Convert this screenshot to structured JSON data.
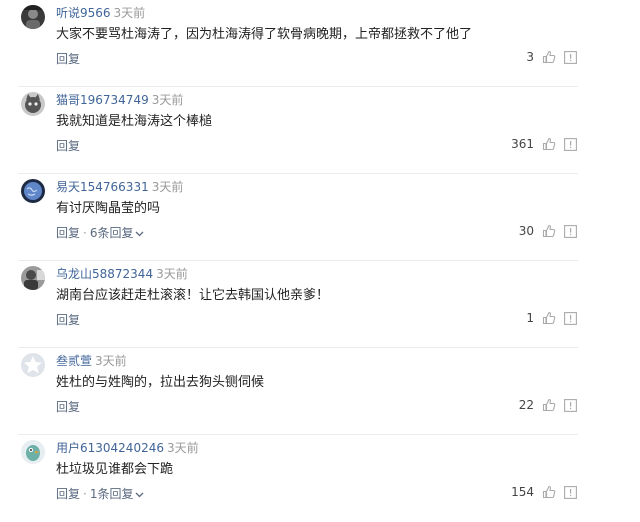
{
  "comments": [
    {
      "username": "听说9566",
      "time": "3天前",
      "text": "大家不要骂杜海涛了，因为杜海涛得了软骨病晚期，上帝都拯救不了他了",
      "reply_label": "回复",
      "replies_label": "",
      "likes": "3",
      "avatar_icon": "avatar-dark-icon"
    },
    {
      "username": "猫哥196734749",
      "time": "3天前",
      "text": "我就知道是杜海涛这个棒槌",
      "reply_label": "回复",
      "replies_label": "",
      "likes": "361",
      "avatar_icon": "avatar-cat-icon"
    },
    {
      "username": "易天154766331",
      "time": "3天前",
      "text": "有讨厌陶晶莹的吗",
      "reply_label": "回复",
      "replies_label": "6条回复",
      "likes": "30",
      "avatar_icon": "avatar-globe-icon"
    },
    {
      "username": "乌龙山58872344",
      "time": "3天前",
      "text": "湖南台应该赶走杜滚滚！让它去韩国认他亲爹！",
      "reply_label": "回复",
      "replies_label": "",
      "likes": "1",
      "avatar_icon": "avatar-photo-icon"
    },
    {
      "username": "叁贰萱",
      "time": "3天前",
      "text": "姓杜的与姓陶的，拉出去狗头铡伺候",
      "reply_label": "回复",
      "replies_label": "",
      "likes": "22",
      "avatar_icon": "avatar-default-icon"
    },
    {
      "username": "用户61304240246",
      "time": "3天前",
      "text": "杜垃圾见谁都会下跪",
      "reply_label": "回复",
      "replies_label": "1条回复",
      "likes": "154",
      "avatar_icon": "avatar-bird-icon"
    }
  ],
  "colors": {
    "username": "#406599",
    "time": "#999999",
    "action": "#5a6a80",
    "icon": "#aaaaaa"
  }
}
